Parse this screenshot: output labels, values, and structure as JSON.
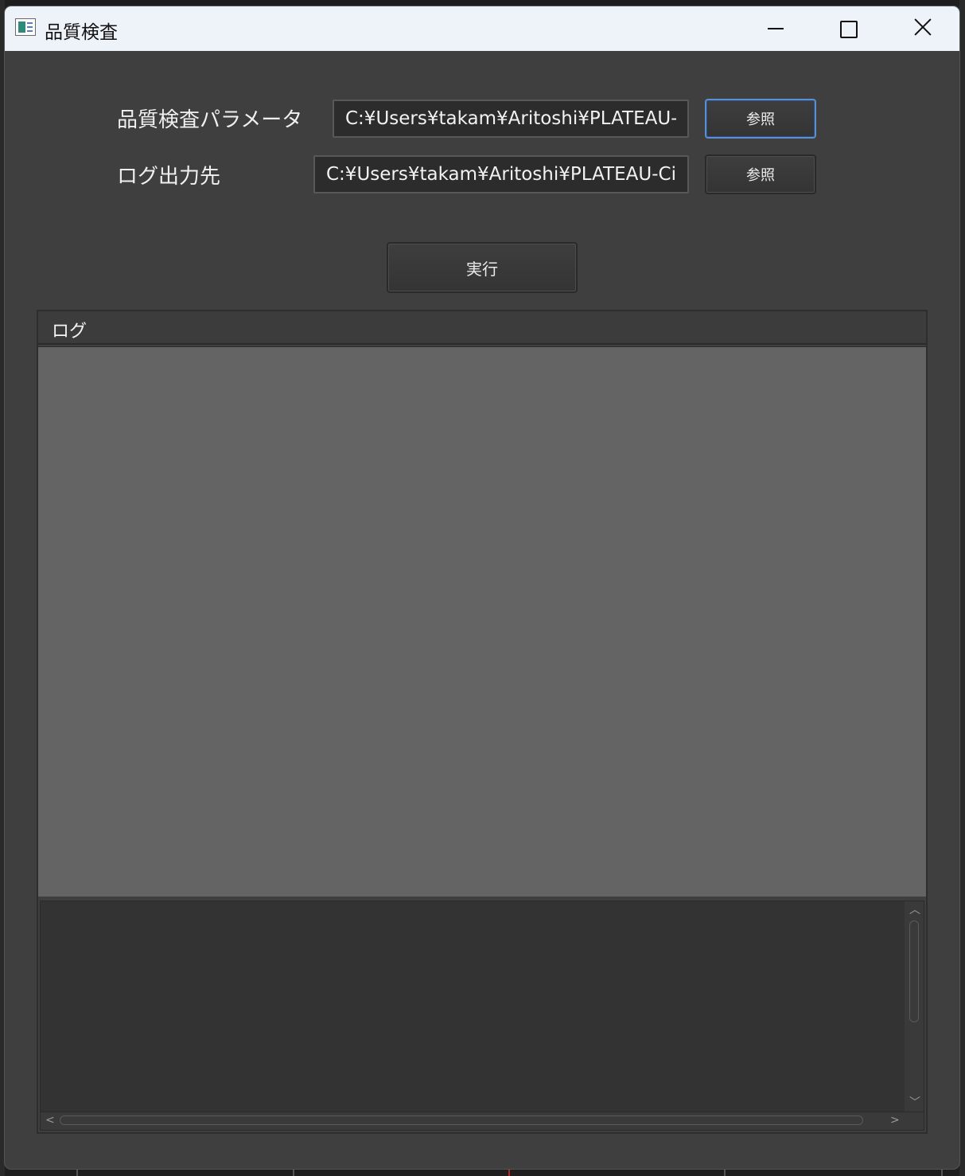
{
  "window": {
    "title": "品質検査",
    "controls": {
      "minimize": "minimize-icon",
      "maximize": "maximize-icon",
      "close": "close-icon"
    }
  },
  "form": {
    "params": {
      "label": "品質検査パラメータ",
      "value": "C:¥Users¥takam¥Aritoshi¥PLATEAU-",
      "browse_label": "参照"
    },
    "log_dest": {
      "label": "ログ出力先",
      "value": "C:¥Users¥takam¥Aritoshi¥PLATEAU-Ci",
      "browse_label": "参照"
    },
    "run_label": "実行"
  },
  "log": {
    "header": "ログ"
  },
  "colors": {
    "window_bg": "#3f3f3f",
    "titlebar_bg": "#eef2f9",
    "focus_border": "#5b8fd1",
    "log_area_bg": "#646464",
    "log_output_bg": "#333333"
  }
}
